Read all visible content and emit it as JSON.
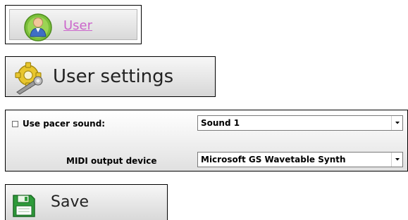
{
  "user_tab": {
    "label": "User",
    "icon": "user-avatar-icon",
    "link_color": "#cc66cc"
  },
  "settings_header": {
    "title": "User settings",
    "icon": "gear-wrench-icon"
  },
  "pacer_sound": {
    "checkbox_checked": false,
    "label": "Use pacer sound:",
    "selected": "Sound 1"
  },
  "midi_output": {
    "label": "MIDI output device",
    "selected": "Microsoft GS Wavetable Synth"
  },
  "save_button": {
    "label": "Save",
    "icon": "floppy-disk-icon",
    "icon_color": "#2e9b3a"
  }
}
